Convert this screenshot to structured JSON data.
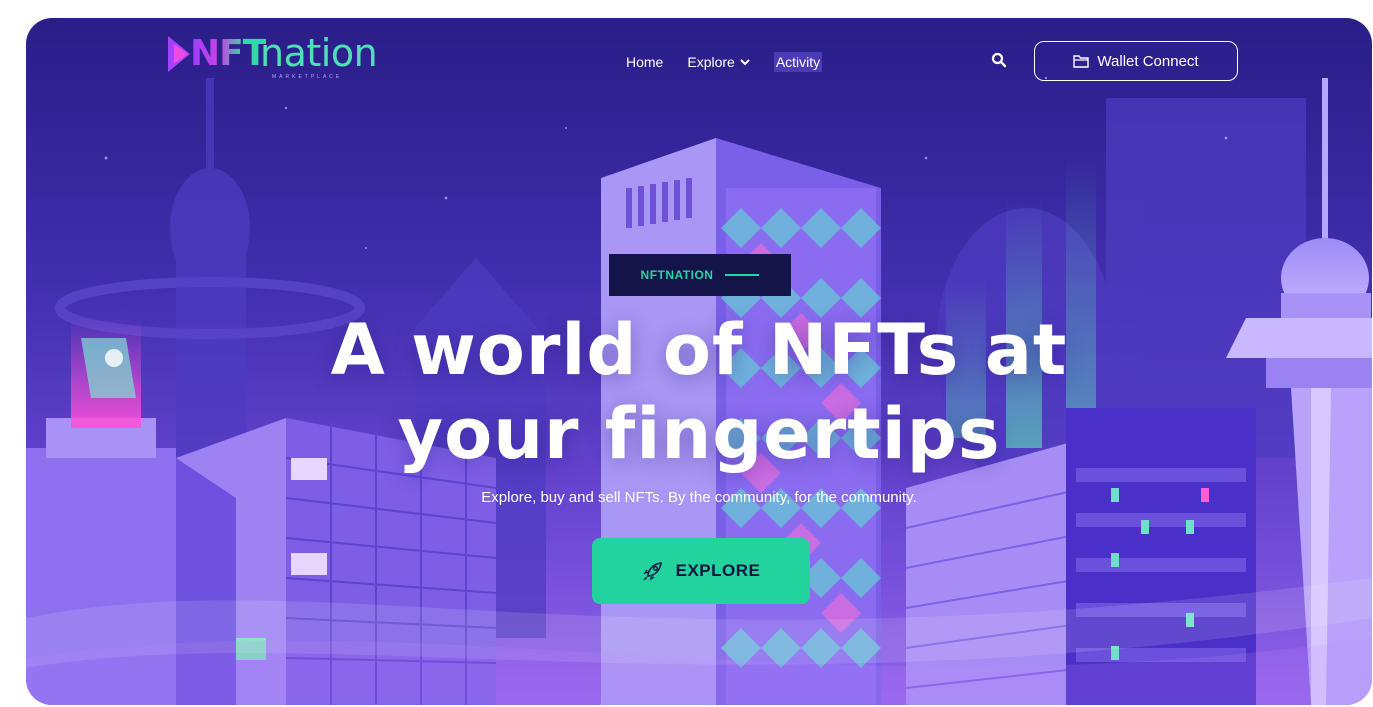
{
  "brand": {
    "strong": "NFT",
    "light": "nation",
    "subtitle": "MARKETPLACE"
  },
  "nav": {
    "links": [
      {
        "label": "Home"
      },
      {
        "label": "Explore",
        "icon": "chevron-down-icon"
      },
      {
        "label": "Activity",
        "active": true
      }
    ],
    "search_icon": "search-icon",
    "wallet_label": "Wallet Connect",
    "wallet_icon": "folder-icon"
  },
  "hero": {
    "tag": "NFTNATION",
    "title_line1": "A world of NFTs at",
    "title_line2": "your fingertips",
    "subtitle": "Explore, buy and sell NFTs. By the community, for the community.",
    "cta_label": "EXPLORE",
    "cta_icon": "rocket-icon"
  },
  "colors": {
    "accent": "#22d39e",
    "tag_bg": "#131447",
    "bg_top": "#2a1e87",
    "bg_bottom": "#7d58e6"
  }
}
